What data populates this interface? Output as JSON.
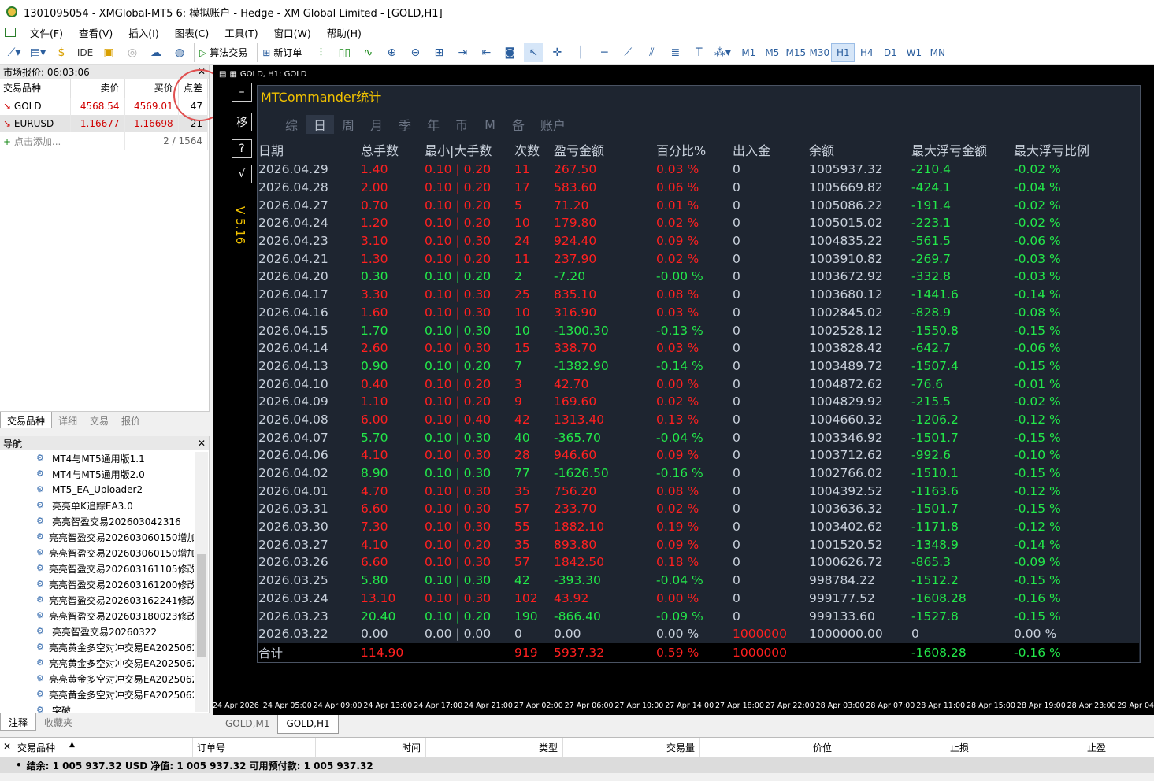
{
  "window": {
    "title": "1301095054 - XMGlobal-MT5 6: 模拟账户 - Hedge - XM Global Limited - [GOLD,H1]"
  },
  "menu": [
    "文件(F)",
    "查看(V)",
    "插入(I)",
    "图表(C)",
    "工具(T)",
    "窗口(W)",
    "帮助(H)"
  ],
  "toolbar": {
    "ide": "IDE",
    "algo_label": "算法交易",
    "new_order_label": "新订单",
    "timeframes": [
      "M1",
      "M5",
      "M15",
      "M30",
      "H1",
      "H4",
      "D1",
      "W1",
      "MN"
    ],
    "active_timeframe": "H1"
  },
  "market_watch": {
    "title": "市场报价: 06:03:06",
    "headers": [
      "交易品种",
      "卖价",
      "买价",
      "点差"
    ],
    "rows": [
      {
        "symbol": "GOLD",
        "bid": "4568.54",
        "ask": "4569.01",
        "spread": "47"
      },
      {
        "symbol": "EURUSD",
        "bid": "1.16677",
        "ask": "1.16698",
        "spread": "21"
      }
    ],
    "add_label": "点击添加...",
    "count": "2 / 1564",
    "tabs": [
      "交易品种",
      "详细",
      "交易",
      "报价"
    ]
  },
  "navigator": {
    "title": "导航",
    "items": [
      "MT4与MT5通用版1.1",
      "MT4与MT5通用版2.0",
      "MT5_EA_Uploader2",
      "亮亮单K追踪EA3.0",
      "亮亮智盈交易202603042316",
      "亮亮智盈交易202603060150增加",
      "亮亮智盈交易202603060150增加",
      "亮亮智盈交易202603161105修改",
      "亮亮智盈交易202603161200修改",
      "亮亮智盈交易202603162241修改",
      "亮亮智盈交易202603180023修改",
      "亮亮智盈交易20260322",
      "亮亮黄金多空对冲交易EA2025062",
      "亮亮黄金多空对冲交易EA2025062",
      "亮亮黄金多空对冲交易EA2025062",
      "亮亮黄金多空对冲交易EA2025062",
      "突破"
    ],
    "tabs": [
      "注释",
      "收藏夹"
    ]
  },
  "chart": {
    "header": "GOLD, H1:  GOLD",
    "side_buttons": [
      "–",
      "移",
      "?",
      "√"
    ],
    "version": "V 5.16",
    "panel_title": "MTCommander统计",
    "panel_tabs": [
      "综",
      "日",
      "周",
      "月",
      "季",
      "年",
      "币",
      "M",
      "备",
      "账户"
    ],
    "active_panel_tab": "日",
    "columns": [
      "日期",
      "总手数",
      "最小|大手数",
      "次数",
      "盈亏金额",
      "百分比%",
      "出入金",
      "余额",
      "最大浮亏金额",
      "最大浮亏比例"
    ],
    "rows": [
      [
        "2026.04.29",
        "1.40",
        "0.10 | 0.20",
        "11",
        "267.50",
        "0.03 %",
        "0",
        "1005937.32",
        "-210.4",
        "-0.02 %"
      ],
      [
        "2026.04.28",
        "2.00",
        "0.10 | 0.20",
        "17",
        "583.60",
        "0.06 %",
        "0",
        "1005669.82",
        "-424.1",
        "-0.04 %"
      ],
      [
        "2026.04.27",
        "0.70",
        "0.10 | 0.20",
        "5",
        "71.20",
        "0.01 %",
        "0",
        "1005086.22",
        "-191.4",
        "-0.02 %"
      ],
      [
        "2026.04.24",
        "1.20",
        "0.10 | 0.20",
        "10",
        "179.80",
        "0.02 %",
        "0",
        "1005015.02",
        "-223.1",
        "-0.02 %"
      ],
      [
        "2026.04.23",
        "3.10",
        "0.10 | 0.30",
        "24",
        "924.40",
        "0.09 %",
        "0",
        "1004835.22",
        "-561.5",
        "-0.06 %"
      ],
      [
        "2026.04.21",
        "1.30",
        "0.10 | 0.20",
        "11",
        "237.90",
        "0.02 %",
        "0",
        "1003910.82",
        "-269.7",
        "-0.03 %"
      ],
      [
        "2026.04.20",
        "0.30",
        "0.10 | 0.20",
        "2",
        "-7.20",
        "-0.00 %",
        "0",
        "1003672.92",
        "-332.8",
        "-0.03 %"
      ],
      [
        "2026.04.17",
        "3.30",
        "0.10 | 0.30",
        "25",
        "835.10",
        "0.08 %",
        "0",
        "1003680.12",
        "-1441.6",
        "-0.14 %"
      ],
      [
        "2026.04.16",
        "1.60",
        "0.10 | 0.30",
        "10",
        "316.90",
        "0.03 %",
        "0",
        "1002845.02",
        "-828.9",
        "-0.08 %"
      ],
      [
        "2026.04.15",
        "1.70",
        "0.10 | 0.30",
        "10",
        "-1300.30",
        "-0.13 %",
        "0",
        "1002528.12",
        "-1550.8",
        "-0.15 %"
      ],
      [
        "2026.04.14",
        "2.60",
        "0.10 | 0.30",
        "15",
        "338.70",
        "0.03 %",
        "0",
        "1003828.42",
        "-642.7",
        "-0.06 %"
      ],
      [
        "2026.04.13",
        "0.90",
        "0.10 | 0.20",
        "7",
        "-1382.90",
        "-0.14 %",
        "0",
        "1003489.72",
        "-1507.4",
        "-0.15 %"
      ],
      [
        "2026.04.10",
        "0.40",
        "0.10 | 0.20",
        "3",
        "42.70",
        "0.00 %",
        "0",
        "1004872.62",
        "-76.6",
        "-0.01 %"
      ],
      [
        "2026.04.09",
        "1.10",
        "0.10 | 0.20",
        "9",
        "169.60",
        "0.02 %",
        "0",
        "1004829.92",
        "-215.5",
        "-0.02 %"
      ],
      [
        "2026.04.08",
        "6.00",
        "0.10 | 0.40",
        "42",
        "1313.40",
        "0.13 %",
        "0",
        "1004660.32",
        "-1206.2",
        "-0.12 %"
      ],
      [
        "2026.04.07",
        "5.70",
        "0.10 | 0.30",
        "40",
        "-365.70",
        "-0.04 %",
        "0",
        "1003346.92",
        "-1501.7",
        "-0.15 %"
      ],
      [
        "2026.04.06",
        "4.10",
        "0.10 | 0.30",
        "28",
        "946.60",
        "0.09 %",
        "0",
        "1003712.62",
        "-992.6",
        "-0.10 %"
      ],
      [
        "2026.04.02",
        "8.90",
        "0.10 | 0.30",
        "77",
        "-1626.50",
        "-0.16 %",
        "0",
        "1002766.02",
        "-1510.1",
        "-0.15 %"
      ],
      [
        "2026.04.01",
        "4.70",
        "0.10 | 0.30",
        "35",
        "756.20",
        "0.08 %",
        "0",
        "1004392.52",
        "-1163.6",
        "-0.12 %"
      ],
      [
        "2026.03.31",
        "6.60",
        "0.10 | 0.30",
        "57",
        "233.70",
        "0.02 %",
        "0",
        "1003636.32",
        "-1501.7",
        "-0.15 %"
      ],
      [
        "2026.03.30",
        "7.30",
        "0.10 | 0.30",
        "55",
        "1882.10",
        "0.19 %",
        "0",
        "1003402.62",
        "-1171.8",
        "-0.12 %"
      ],
      [
        "2026.03.27",
        "4.10",
        "0.10 | 0.20",
        "35",
        "893.80",
        "0.09 %",
        "0",
        "1001520.52",
        "-1348.9",
        "-0.14 %"
      ],
      [
        "2026.03.26",
        "6.60",
        "0.10 | 0.30",
        "57",
        "1842.50",
        "0.18 %",
        "0",
        "1000626.72",
        "-865.3",
        "-0.09 %"
      ],
      [
        "2026.03.25",
        "5.80",
        "0.10 | 0.30",
        "42",
        "-393.30",
        "-0.04 %",
        "0",
        "998784.22",
        "-1512.2",
        "-0.15 %"
      ],
      [
        "2026.03.24",
        "13.10",
        "0.10 | 0.30",
        "102",
        "43.92",
        "0.00 %",
        "0",
        "999177.52",
        "-1608.28",
        "-0.16 %"
      ],
      [
        "2026.03.23",
        "20.40",
        "0.10 | 0.20",
        "190",
        "-866.40",
        "-0.09 %",
        "0",
        "999133.60",
        "-1527.8",
        "-0.15 %"
      ],
      [
        "2026.03.22",
        "0.00",
        "0.00 | 0.00",
        "0",
        "0.00",
        "0.00 %",
        "1000000",
        "1000000.00",
        "0",
        "0.00 %"
      ]
    ],
    "total": [
      "合计",
      "114.90",
      "",
      "919",
      "5937.32",
      "0.59 %",
      "1000000",
      "",
      "-1608.28",
      "-0.16 %"
    ],
    "time_axis": [
      "24 Apr 2026",
      "24 Apr 05:00",
      "24 Apr 09:00",
      "24 Apr 13:00",
      "24 Apr 17:00",
      "24 Apr 21:00",
      "27 Apr 02:00",
      "27 Apr 06:00",
      "27 Apr 10:00",
      "27 Apr 14:00",
      "27 Apr 18:00",
      "27 Apr 22:00",
      "28 Apr 03:00",
      "28 Apr 07:00",
      "28 Apr 11:00",
      "28 Apr 15:00",
      "28 Apr 19:00",
      "28 Apr 23:00",
      "29 Apr 04:"
    ],
    "tabs": [
      "GOLD,M1",
      "GOLD,H1"
    ],
    "active_tab": "GOLD,H1"
  },
  "terminal": {
    "columns": [
      "交易品种",
      "订单号",
      "时间",
      "类型",
      "交易量",
      "价位",
      "止损",
      "止盈"
    ],
    "status": "结余: 1 005 937.32 USD  净值: 1 005 937.32  可用预付款: 1 005 937.32"
  }
}
